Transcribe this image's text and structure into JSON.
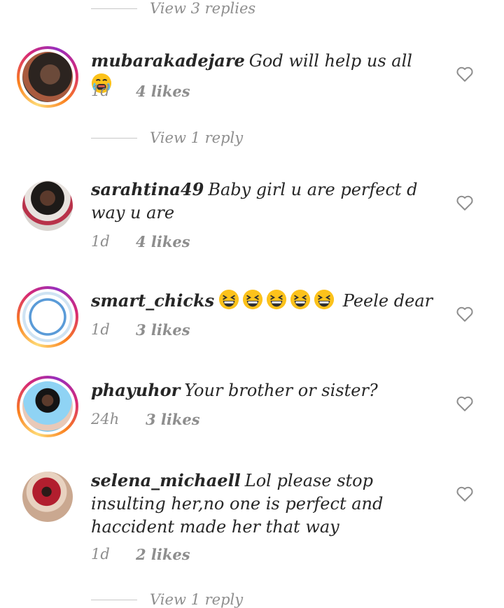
{
  "thread_top": {
    "view_replies": "View 3 replies"
  },
  "comments": [
    {
      "username": "mubarakadejare",
      "text": "God will help us all",
      "emoji": "crying-face",
      "time": "1d",
      "likes": "4 likes",
      "view_replies": "View 1 reply"
    },
    {
      "username": "sarahtina49",
      "text": "Baby girl u are perfect d way u are",
      "time": "1d",
      "likes": "4 likes"
    },
    {
      "username": "smart_chicks",
      "text": "Peele dear",
      "emoji": "grinning-squinting-face x5",
      "time": "1d",
      "likes": "3 likes"
    },
    {
      "username": "phayuhor",
      "text": "Your brother or sister?",
      "time": "24h",
      "likes": "3 likes"
    },
    {
      "username": "selena_michaell",
      "text": "Lol please stop insulting her,no one is perfect and haccident made her that way",
      "time": "1d",
      "likes": "2 likes",
      "view_replies": "View 1 reply"
    }
  ],
  "colors": {
    "primary_text": "#262626",
    "secondary_text": "#8e8e8e",
    "story_ring_start": "#feda75",
    "story_ring_end": "#d62976"
  }
}
